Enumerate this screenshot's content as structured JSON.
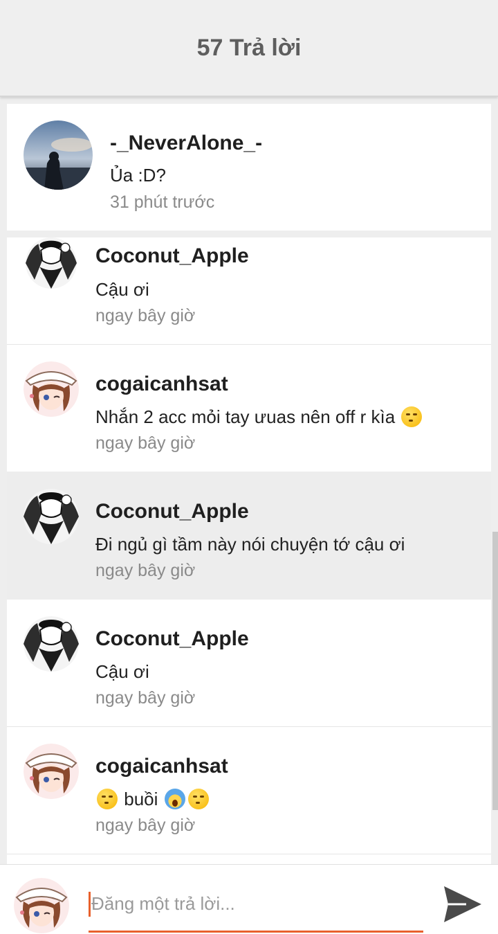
{
  "header": {
    "title": "57 Trả lời"
  },
  "parent_comment": {
    "username": "-_NeverAlone_-",
    "message": "Ủa :D?",
    "time": "31 phút trước"
  },
  "replies": [
    {
      "username": "Coconut_Apple",
      "message": "Cậu ơi",
      "time": "ngay bây giờ",
      "avatar": "manga-boy-avatar"
    },
    {
      "username": "cogaicanhsat",
      "message_text": "Nhắn 2 acc mỏi tay ưuas nên off r kìa",
      "message_emoji_suffix": "smirk-emoji",
      "time": "ngay bây giờ",
      "avatar": "anime-girl-avatar"
    },
    {
      "username": "Coconut_Apple",
      "message": "Đi ngủ gì tầm này nói chuyện tớ cậu ơi",
      "time": "ngay bây giờ",
      "avatar": "manga-boy-avatar",
      "highlighted": true
    },
    {
      "username": "Coconut_Apple",
      "message": "Cậu ơi",
      "time": "ngay bây giờ",
      "avatar": "manga-boy-avatar"
    },
    {
      "username": "cogaicanhsat",
      "message_text": "buồi",
      "message_emojis": [
        "smirk-emoji",
        "scream-emoji",
        "smirk-emoji"
      ],
      "time": "ngay bây giờ",
      "avatar": "anime-girl-avatar"
    }
  ],
  "composer": {
    "placeholder": "Đăng một trả lời...",
    "send_icon": "send-icon"
  },
  "colors": {
    "accent": "#e8602c",
    "header_bg": "#efefef",
    "highlight_bg": "#ededed"
  }
}
